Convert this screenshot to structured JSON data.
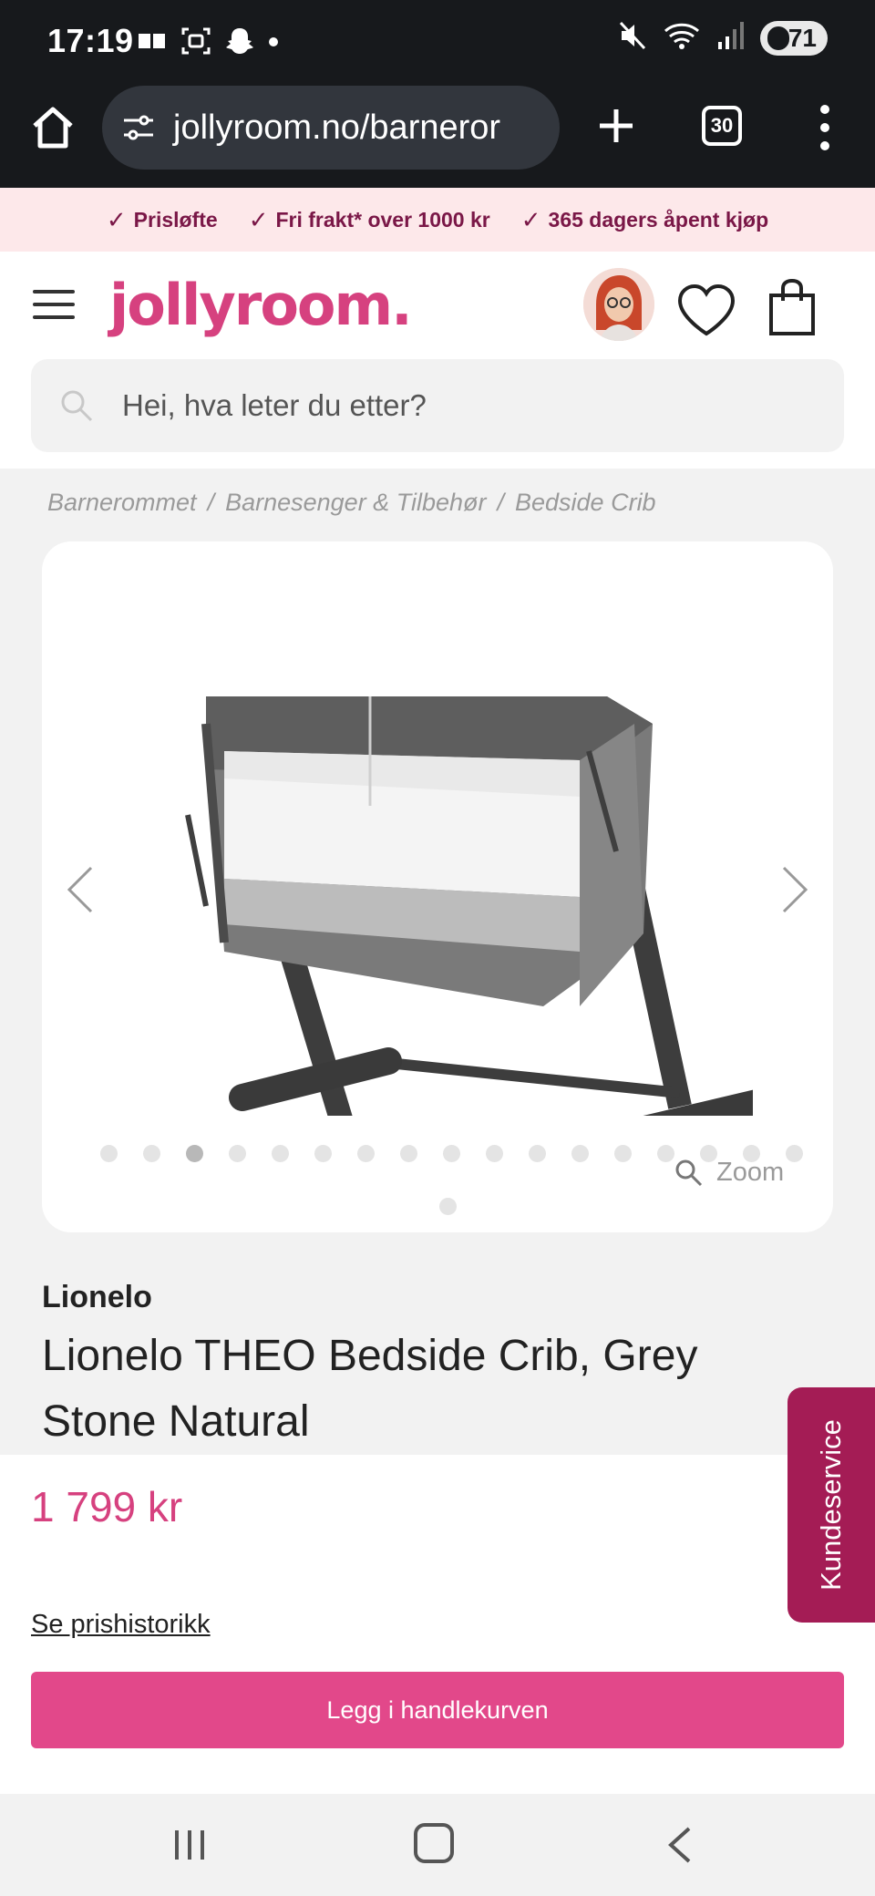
{
  "status_bar": {
    "time": "17:19",
    "battery": "71",
    "notification_icons": [
      "message-icon",
      "screenshot-icon",
      "snapchat-icon",
      "dot-icon"
    ],
    "system_icons": [
      "mute-icon",
      "wifi-icon",
      "signal-icon",
      "battery-icon"
    ]
  },
  "browser": {
    "url": "jollyroom.no/barneror",
    "tab_count": "30"
  },
  "usp_bar": {
    "items": [
      "Prisløfte",
      "Fri frakt* over 1000 kr",
      "365 dagers åpent kjøp"
    ]
  },
  "header": {
    "logo": "jollyroom.",
    "search_placeholder": "Hei, hva leter du etter?"
  },
  "breadcrumb": [
    "Barnerommet",
    "Barnesenger & Tilbehør",
    "Bedside Crib"
  ],
  "gallery": {
    "image_alt": "Lionelo THEO Bedside Crib",
    "dot_count": 18,
    "active_dot": 2,
    "zoom_label": "Zoom"
  },
  "product": {
    "brand": "Lionelo",
    "title": "Lionelo THEO Bedside Crib, Grey Stone Natural",
    "price": "1 799 kr",
    "price_history_link": "Se prishistorikk",
    "add_to_cart": "Legg i handlekurven"
  },
  "customer_service": {
    "label": "Kundeservice"
  },
  "colors": {
    "brand_pink": "#d6417f",
    "cta_pink": "#e2488a",
    "customer_service_bg": "#a41c55",
    "usp_bg": "#fde8ea"
  }
}
